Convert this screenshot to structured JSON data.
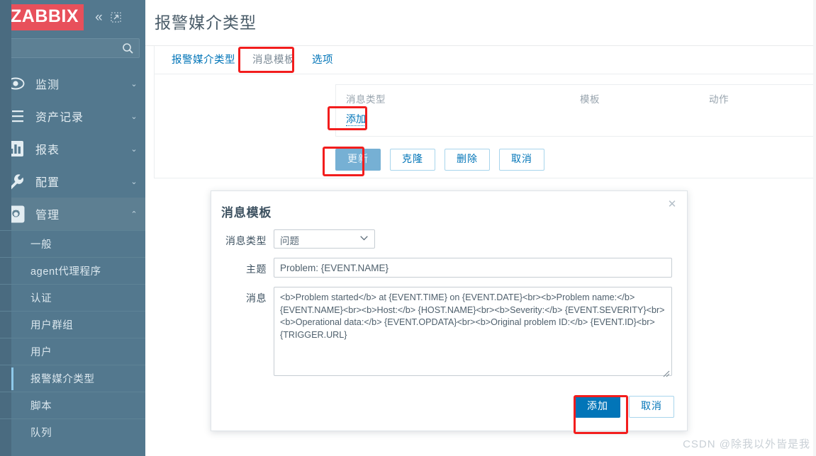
{
  "sidebar": {
    "logo": "ZABBIX",
    "collapse_icon": "chevron-double-left-icon",
    "expand_icon": "expand-frame-icon",
    "search": {
      "value": "",
      "placeholder": "",
      "icon": "search-icon"
    },
    "items": [
      {
        "label": "监测",
        "icon": "eye-icon",
        "chevron": "⌄",
        "active": false
      },
      {
        "label": "资产记录",
        "icon": "list-icon",
        "chevron": "⌄",
        "active": false
      },
      {
        "label": "报表",
        "icon": "bar-chart-icon",
        "chevron": "⌄",
        "active": false
      },
      {
        "label": "配置",
        "icon": "wrench-icon",
        "chevron": "⌄",
        "active": false
      },
      {
        "label": "管理",
        "icon": "gear-icon",
        "chevron": "⌃",
        "active": true
      }
    ],
    "subitems": [
      {
        "label": "一般",
        "selected": false
      },
      {
        "label": "agent代理程序",
        "selected": false
      },
      {
        "label": "认证",
        "selected": false
      },
      {
        "label": "用户群组",
        "selected": false
      },
      {
        "label": "用户",
        "selected": false
      },
      {
        "label": "报警媒介类型",
        "selected": true
      },
      {
        "label": "脚本",
        "selected": false
      },
      {
        "label": "队列",
        "selected": false
      }
    ]
  },
  "header": {
    "title": "报警媒介类型"
  },
  "tabs": [
    {
      "label": "报警媒介类型",
      "selected": false
    },
    {
      "label": "消息模板",
      "selected": true
    },
    {
      "label": "选项",
      "selected": false
    }
  ],
  "table": {
    "columns": {
      "type": "消息类型",
      "template": "模板",
      "action": "动作"
    },
    "add_link": "添加"
  },
  "form_buttons": {
    "update": "更新",
    "clone": "克隆",
    "delete": "删除",
    "cancel": "取消"
  },
  "modal": {
    "title": "消息模板",
    "close_icon": "close-icon",
    "fields": {
      "message_type_label": "消息类型",
      "message_type_value": "问题",
      "message_type_options": [
        "问题"
      ],
      "subject_label": "主题",
      "subject_value": "Problem: {EVENT.NAME}",
      "message_label": "消息",
      "message_value": "<b>Problem started</b> at {EVENT.TIME} on {EVENT.DATE}<br><b>Problem name:</b> {EVENT.NAME}<br><b>Host:</b> {HOST.NAME}<br><b>Severity:</b> {EVENT.SEVERITY}<br><b>Operational data:</b> {EVENT.OPDATA}<br><b>Original problem ID:</b> {EVENT.ID}<br>{TRIGGER.URL}"
    },
    "buttons": {
      "add": "添加",
      "cancel": "取消"
    }
  },
  "watermark": "CSDN @除我以外皆是我",
  "colors": {
    "sidebar_bg": "#53788e",
    "logo_bg": "#e8505b",
    "link_blue": "#0275b8",
    "annotation_red": "#f21d1d",
    "primary_button": "#0275b8",
    "muted_button": "#76b0d4"
  }
}
